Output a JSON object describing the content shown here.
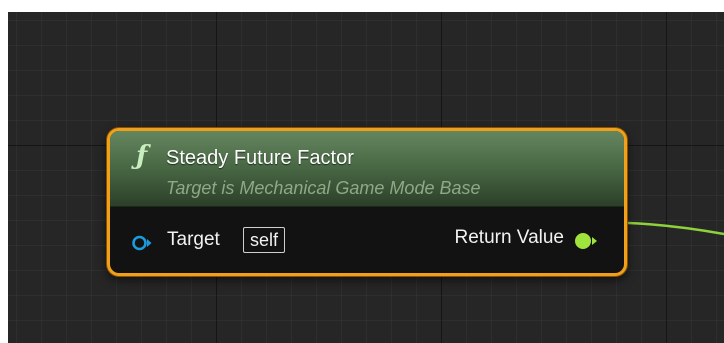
{
  "node": {
    "title": "Steady Future Factor",
    "subtitle": "Target is Mechanical Game Mode Base",
    "function_icon": "ƒ",
    "header_color": "#4a6a46",
    "border_color": "#f0a01a"
  },
  "pins": {
    "target": {
      "label": "Target",
      "default_value": "self",
      "icon": "object-reference-pin-icon",
      "color": "#1c9bdc"
    },
    "return_value": {
      "label": "Return Value",
      "icon": "float-pin-icon",
      "color": "#9fe33d"
    }
  },
  "wire": {
    "color": "#8ed13b"
  }
}
